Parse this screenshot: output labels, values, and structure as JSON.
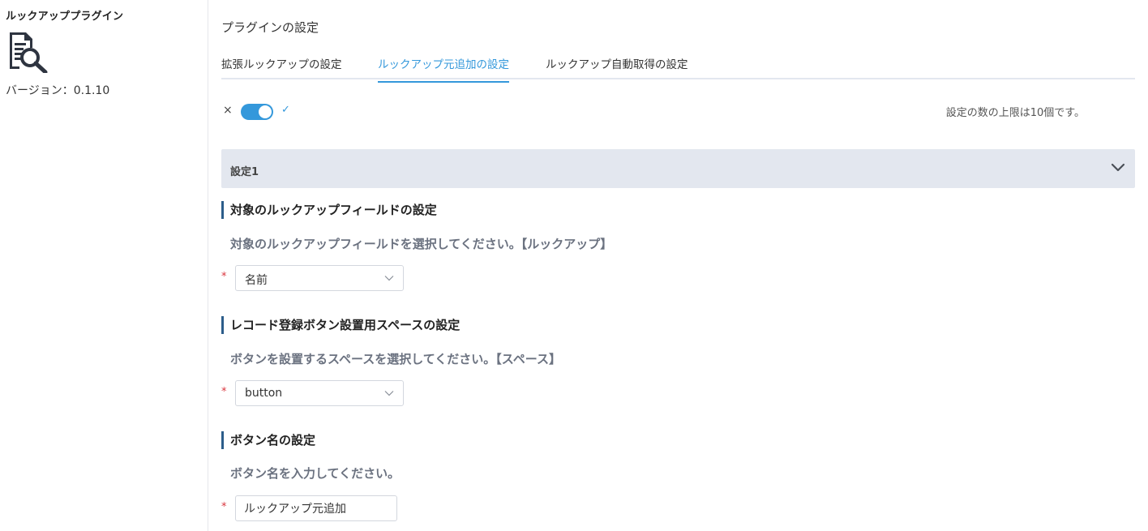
{
  "sidebar": {
    "plugin_name": "ルックアッププラグイン",
    "plugin_icon": "document-search-icon",
    "version": "バージョン：0.1.10"
  },
  "main": {
    "title": "プラグインの設定",
    "tabs": [
      {
        "label": "拡張ルックアップの設定",
        "active": false
      },
      {
        "label": "ルックアップ元追加の設定",
        "active": true
      },
      {
        "label": "ルックアップ自動取得の設定",
        "active": false
      }
    ],
    "toggle": {
      "off_mark": "×",
      "on_mark": "✓",
      "state": "on"
    },
    "limit_text": "設定の数の上限は10個です。",
    "accordion": {
      "title": "設定1",
      "icon": "chevron-down-icon"
    },
    "sections": [
      {
        "heading": "対象のルックアップフィールドの設定",
        "description": "対象のルックアップフィールドを選択してください。【ルックアップ】",
        "required_mark": "*",
        "select_value": "名前"
      },
      {
        "heading": "レコード登録ボタン設置用スペースの設定",
        "description": "ボタンを設置するスペースを選択してください。【スペース】",
        "required_mark": "*",
        "select_value": "button"
      },
      {
        "heading": "ボタン名の設定",
        "description": "ボタン名を入力してください。",
        "required_mark": "*",
        "input_value": "ルックアップ元追加"
      }
    ]
  },
  "colors": {
    "accent": "#3498db",
    "section_bar": "#2c5d8a",
    "accordion_bg": "#e3e7ef",
    "required": "#d9363e",
    "description": "#6b7280"
  }
}
